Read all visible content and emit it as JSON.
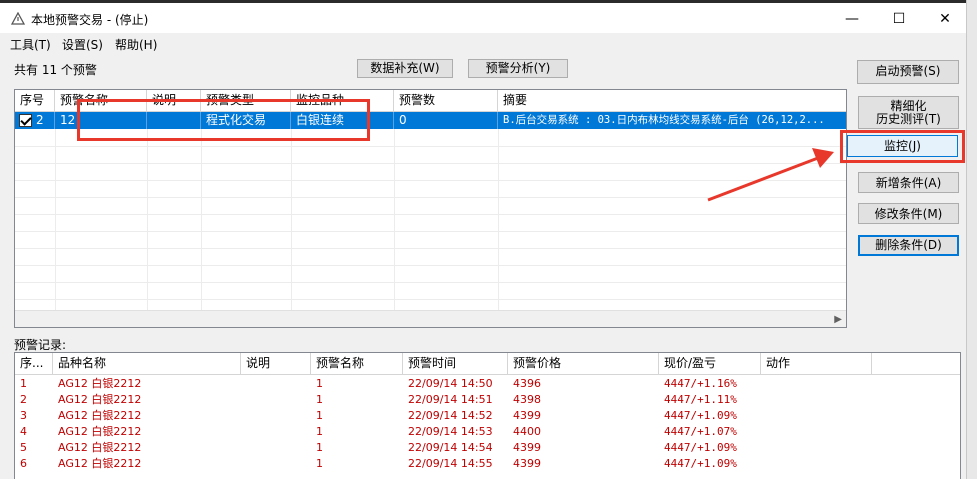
{
  "window": {
    "title": "本地预警交易 - (停止)",
    "minimize_glyph": "—",
    "maximize_glyph": "☐",
    "close_glyph": "✕"
  },
  "menu": [
    "工具(T)",
    "设置(S)",
    "帮助(H)"
  ],
  "summary_text": "共有 11 个预警",
  "toolbar": {
    "data_fill_label": "数据补充(W)",
    "alert_analysis_label": "预警分析(Y)"
  },
  "right_buttons": {
    "start_alert": "启动预警(S)",
    "refine_line1": "精细化",
    "refine_line2": "历史测评(T)",
    "monitor": "监控(J)",
    "add_condition": "新增条件(A)",
    "modify_condition": "修改条件(M)",
    "delete_condition": "删除条件(D)"
  },
  "alert_table": {
    "columns": [
      "序号",
      "预警名称",
      "说明",
      "预警类型",
      "监控品种",
      "预警数",
      "摘要"
    ],
    "rows": [
      {
        "index": "2",
        "name": "12",
        "desc": "",
        "type": "程式化交易",
        "symbol": "白银连续",
        "count": "0",
        "summary": "B.后台交易系统 : 03.日内布林均线交易系统-后台 (26,12,2..."
      }
    ]
  },
  "log_label": "预警记录:",
  "log_table": {
    "columns": [
      "序...",
      "品种名称",
      "说明",
      "预警名称",
      "预警时间",
      "预警价格",
      "现价/盈亏",
      "动作"
    ],
    "rows": [
      {
        "seq": "1",
        "product": "AG12 白银2212",
        "note": "",
        "alert": "1",
        "time": "22/09/14 14:50",
        "price": "4396",
        "pnl": "4447/+1.16%",
        "action": ""
      },
      {
        "seq": "2",
        "product": "AG12 白银2212",
        "note": "",
        "alert": "1",
        "time": "22/09/14 14:51",
        "price": "4398",
        "pnl": "4447/+1.11%",
        "action": ""
      },
      {
        "seq": "3",
        "product": "AG12 白银2212",
        "note": "",
        "alert": "1",
        "time": "22/09/14 14:52",
        "price": "4399",
        "pnl": "4447/+1.09%",
        "action": ""
      },
      {
        "seq": "4",
        "product": "AG12 白银2212",
        "note": "",
        "alert": "1",
        "time": "22/09/14 14:53",
        "price": "4400",
        "pnl": "4447/+1.07%",
        "action": ""
      },
      {
        "seq": "5",
        "product": "AG12 白银2212",
        "note": "",
        "alert": "1",
        "time": "22/09/14 14:54",
        "price": "4399",
        "pnl": "4447/+1.09%",
        "action": ""
      },
      {
        "seq": "6",
        "product": "AG12 白银2212",
        "note": "",
        "alert": "1",
        "time": "22/09/14 14:55",
        "price": "4399",
        "pnl": "4447/+1.09%",
        "action": ""
      }
    ]
  },
  "colors": {
    "selection": "#0078d7",
    "log_text": "#c00000",
    "annotation": "#e8382c"
  },
  "icons": {
    "app": "warning-triangle-icon",
    "scroll_right": "chevron-right-icon",
    "checkbox": "checkbox-checked-icon"
  }
}
